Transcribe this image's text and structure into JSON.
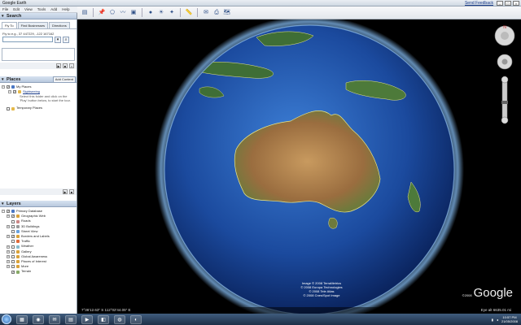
{
  "window": {
    "title": "Google Earth",
    "feedback_link": "Send Feedback"
  },
  "menu": [
    "File",
    "Edit",
    "View",
    "Tools",
    "Add",
    "Help"
  ],
  "search": {
    "header": "Search",
    "tabs": [
      "Fly To",
      "Find Businesses",
      "Directions"
    ],
    "hint": "Fly to e.g., 37 447229, -122 167162",
    "input_value": ""
  },
  "places": {
    "header": "Places",
    "add_content": "Add Content",
    "items": [
      {
        "label": "My Places",
        "level": 0
      },
      {
        "label": "Sightseeing",
        "level": 1,
        "link": true
      },
      {
        "label": "Temporary Places",
        "level": 0
      }
    ],
    "sightseeing_desc": "Select this folder and click on the 'Play' button below, to start the tour."
  },
  "layers": {
    "header": "Layers",
    "items": [
      "Primary Database",
      "Geographic Web",
      "Roads",
      "3D Buildings",
      "Street View",
      "Borders and Labels",
      "Traffic",
      "Weather",
      "Gallery",
      "Global Awareness",
      "Places of Interest",
      "More",
      "Terrain"
    ]
  },
  "map": {
    "credits": [
      "Image © 2008 TerraMetrics",
      "© 2008 Europa Technologies",
      "© 2008 Tele Atlas",
      "© 2008 Cnes/Spot Image"
    ],
    "logo": "Google",
    "logo_year": "©2008"
  },
  "status": {
    "coords": "7°36'12.63\" S   112°02'44.05\" E",
    "eye_alt": "Eye alt  6635.01 mi"
  },
  "taskbar": {
    "time": "10:57 PM",
    "date": "21/05/2008"
  },
  "colors": {
    "accent": "#2d4f86",
    "ocean": "#1d4fa8",
    "land": "#a87b4c"
  }
}
